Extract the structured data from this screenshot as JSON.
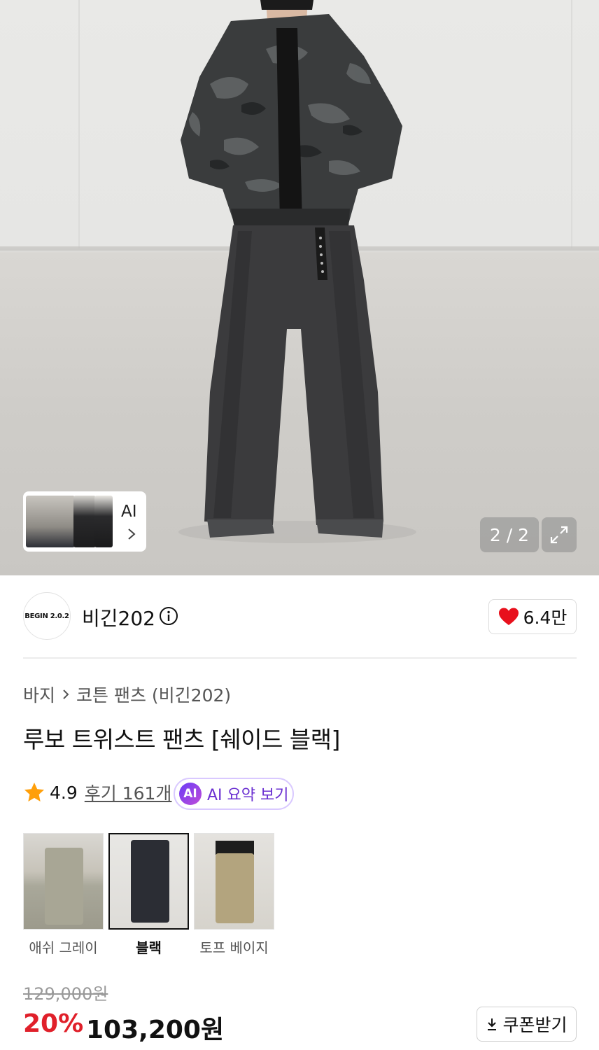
{
  "gallery": {
    "pager_text": "2 / 2",
    "ai_label": "AI"
  },
  "brand": {
    "logo_text": "BEGIN 2.0.2",
    "name": "비긴202",
    "likes": "6.4만"
  },
  "breadcrumb": {
    "category": "바지",
    "subcategory": "코튼 팬츠 (비긴202)"
  },
  "product": {
    "title": "루보 트위스트 팬츠 [쉐이드 블랙]",
    "rating": "4.9",
    "reviews_label": "후기 161개",
    "ai_summary_badge": "AI",
    "ai_summary_label": "AI 요약 보기"
  },
  "color_options": [
    {
      "label": "애쉬 그레이",
      "selected": false
    },
    {
      "label": "블랙",
      "selected": true
    },
    {
      "label": "토프 베이지",
      "selected": false
    }
  ],
  "pricing": {
    "original": "129,000원",
    "discount": "20%",
    "sale": "103,200원",
    "coupon_label": "쿠폰받기"
  },
  "colors": {
    "discount_red": "#e0202a",
    "like_heart": "#e8101c",
    "ai_purple": "#6a2fd1"
  }
}
